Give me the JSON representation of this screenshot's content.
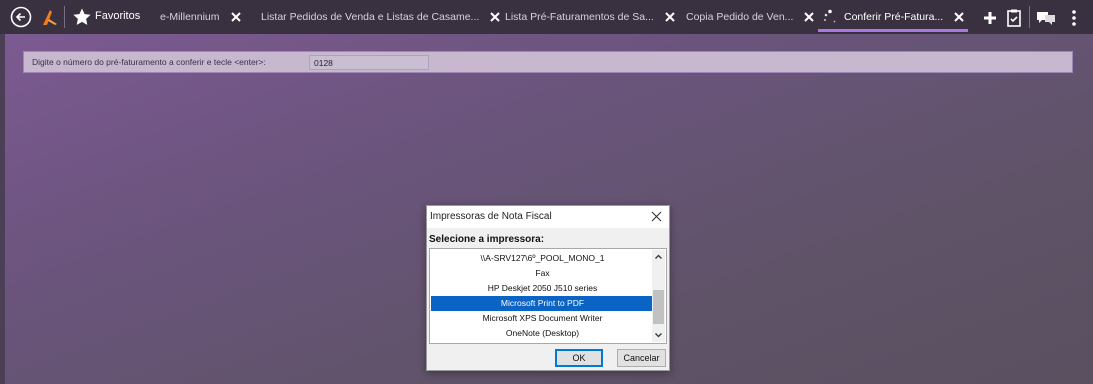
{
  "topbar": {
    "favorites_label": "Favoritos",
    "tabs": [
      {
        "label": "e-Millennium"
      },
      {
        "label": "Listar Pedidos de Venda e Listas de Casame..."
      },
      {
        "label": "Lista Pré-Faturamentos de Sa..."
      },
      {
        "label": "Copia Pedido de Ven..."
      },
      {
        "label": "Conferir Pré-Fatura..."
      }
    ],
    "active_tab_index": 4,
    "accent_color": "#a978e0"
  },
  "prompt": {
    "label": "Digite o número do pré-faturamento a conferir e tecle <enter>:",
    "value": "0128"
  },
  "dialog": {
    "title": "Impressoras de Nota Fiscal",
    "subtitle": "Selecione a impressora:",
    "printers": [
      "\\\\A-SRV127\\6º_POOL_MONO_1",
      "Fax",
      "HP Deskjet 2050 J510 series",
      "Microsoft Print to PDF",
      "Microsoft XPS Document Writer",
      "OneNote (Desktop)"
    ],
    "selected_index": 3,
    "selection_color": "#0b63c5",
    "ok_label": "OK",
    "cancel_label": "Cancelar"
  }
}
